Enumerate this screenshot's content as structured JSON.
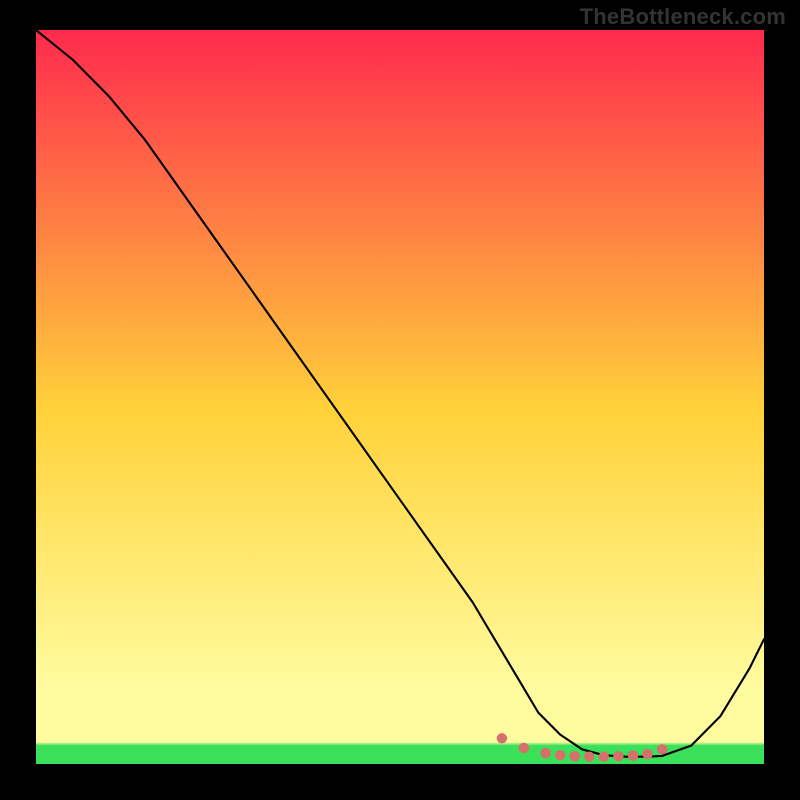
{
  "watermark": "TheBottleneck.com",
  "colors": {
    "bg": "#000000",
    "curve": "#000000",
    "dots": "#d86f6b",
    "greenBand": "#3adf5a",
    "gradTop": "#ff2a4d",
    "gradMid": "#ffd23a",
    "gradLow": "#fffca0",
    "gradBottom": "#3adf5a"
  },
  "chart_data": {
    "type": "line",
    "title": "",
    "xlabel": "",
    "ylabel": "",
    "xlim": [
      0,
      100
    ],
    "ylim": [
      0,
      100
    ],
    "x": [
      0,
      5,
      10,
      15,
      20,
      25,
      30,
      35,
      40,
      45,
      50,
      55,
      60,
      63,
      66,
      69,
      72,
      75,
      78,
      81,
      84,
      86,
      90,
      94,
      98,
      100
    ],
    "values": [
      100,
      96,
      91,
      85,
      78,
      71,
      64,
      57,
      50,
      43,
      36,
      29,
      22,
      17,
      12,
      7,
      4,
      2,
      1.2,
      1.0,
      1.0,
      1.1,
      2.5,
      6.5,
      13,
      17
    ],
    "dots_x": [
      64,
      67,
      70,
      72,
      74,
      76,
      78,
      80,
      82,
      84,
      86
    ],
    "dots_y": [
      3.5,
      2.2,
      1.5,
      1.2,
      1.05,
      1.0,
      1.0,
      1.05,
      1.15,
      1.35,
      2.0
    ],
    "annotations": []
  }
}
